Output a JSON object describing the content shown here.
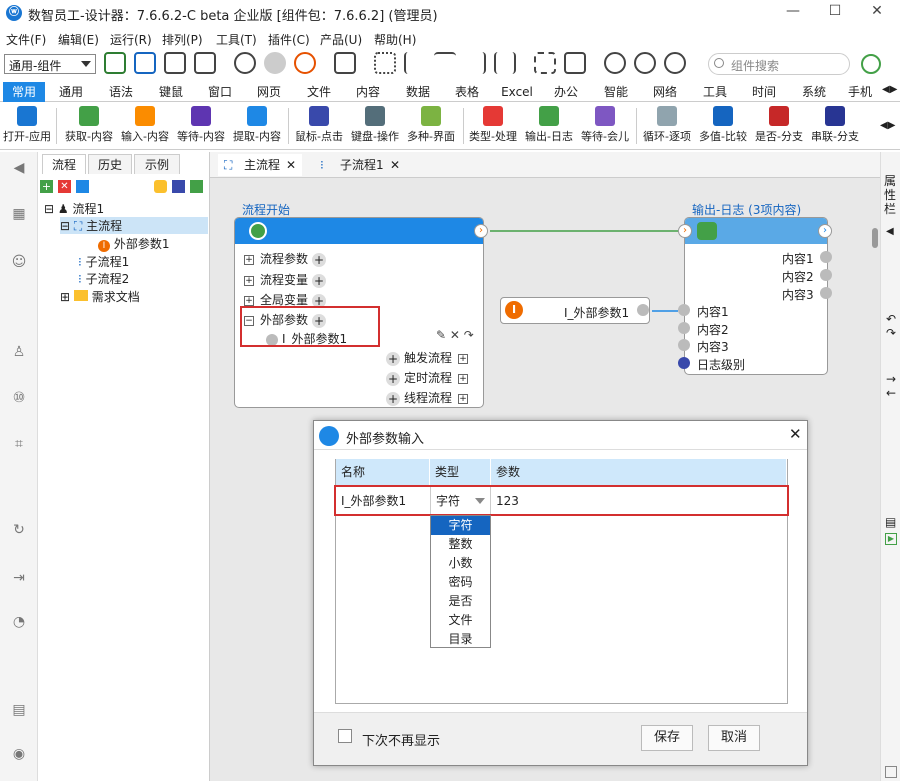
{
  "window": {
    "title": "数智员工-设计器：7.6.6.2-C beta 企业版 [组件包：7.6.6.2]  (管理员)",
    "min": "—",
    "max": "☐",
    "close": "✕",
    "logo": "ⓦ"
  },
  "menu": [
    "文件(F)",
    "编辑(E)",
    "运行(R)",
    "排列(P)",
    "工具(T)",
    "插件(C)",
    "产品(U)",
    "帮助(H)"
  ],
  "toolbar": {
    "combo_value": "通用-组件",
    "search_placeholder": "组件搜索"
  },
  "ribbon_tabs": [
    "常用",
    "通用",
    "语法",
    "键鼠",
    "窗口",
    "网页",
    "文件",
    "内容",
    "数据",
    "表格",
    "Excel",
    "办公",
    "智能",
    "网络",
    "工具",
    "时间",
    "系统",
    "手机"
  ],
  "ribbon_items": [
    "打开-应用",
    "获取-内容",
    "输入-内容",
    "等待-内容",
    "提取-内容",
    "鼠标-点击",
    "键盘-操作",
    "多种-界面",
    "类型-处理",
    "输出-日志",
    "等待-会儿",
    "循环-逐项",
    "多值-比较",
    "是否-分支",
    "串联-分支"
  ],
  "panel": {
    "tabs": [
      "流程",
      "历史",
      "示例"
    ],
    "tree": [
      {
        "label": "流程1"
      },
      {
        "label": "主流程"
      },
      {
        "label": "外部参数1"
      },
      {
        "label": "子流程1"
      },
      {
        "label": "子流程2"
      },
      {
        "label": "需求文档"
      }
    ]
  },
  "doc_tabs": [
    {
      "label": "主流程"
    },
    {
      "label": "子流程1"
    }
  ],
  "start_node": {
    "title": "流程开始",
    "rows": [
      "流程参数",
      "流程变量",
      "全局变量",
      "外部参数"
    ],
    "param": "I_外部参数1",
    "right_rows": [
      "触发流程",
      "定时流程",
      "线程流程"
    ]
  },
  "param_node": {
    "label": "I_外部参数1"
  },
  "log_node": {
    "title": "输出-日志 (3项内容)",
    "outputs": [
      "内容1",
      "内容2",
      "内容3"
    ],
    "inputs": [
      "内容1",
      "内容2",
      "内容3",
      "日志级别"
    ]
  },
  "right_panel": {
    "label": "属性栏"
  },
  "dialog": {
    "title": "外部参数输入",
    "columns": [
      "名称",
      "类型",
      "参数"
    ],
    "row": {
      "name": "I_外部参数1",
      "type": "字符",
      "value": "123"
    },
    "type_options": [
      "字符",
      "整数",
      "小数",
      "密码",
      "是否",
      "文件",
      "目录"
    ],
    "dont_show": "下次不再显示",
    "save": "保存",
    "cancel": "取消"
  },
  "colors": {
    "accent": "#1e88e5",
    "highlight": "#d32f2f"
  }
}
